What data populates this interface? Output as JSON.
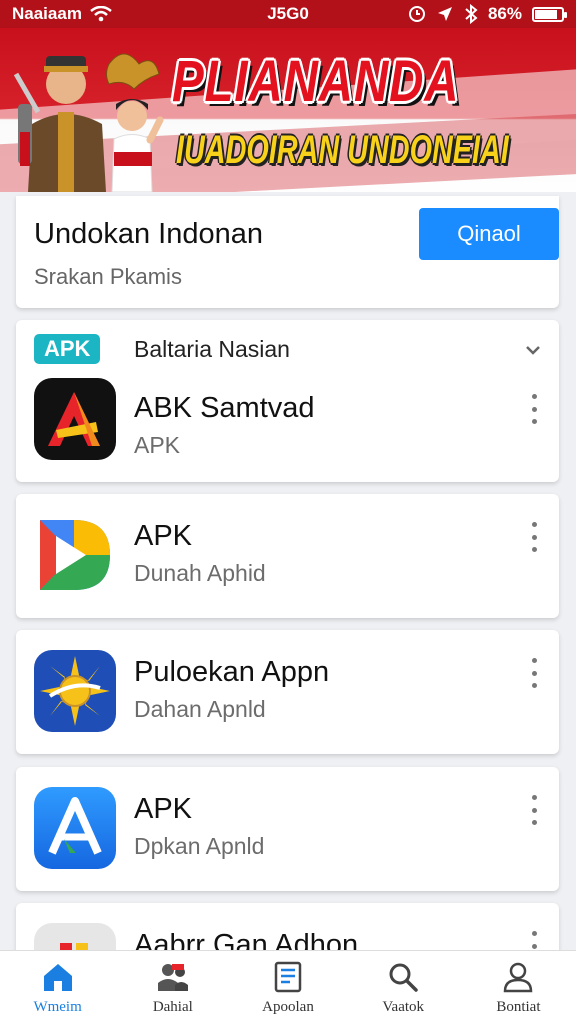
{
  "status_bar": {
    "carrier": "Naaiaam",
    "time": "J5G0",
    "battery": "86%",
    "battery_level": 0.86
  },
  "banner": {
    "title": "PLIANANDA",
    "subtitle": "IUADOIRAN UNDONEIAI"
  },
  "search": {
    "title": "Undokan Indonan",
    "subtitle": "Srakan Pkamis",
    "button_label": "Qinaol"
  },
  "section": {
    "badge": "APK",
    "title": "Baltaria Nasian"
  },
  "apps": [
    {
      "name": "ABK Samtvad",
      "sub": "APK",
      "icon": "red-a-triangle-icon"
    },
    {
      "name": "APK",
      "sub": "Dunah Aphid",
      "icon": "colorful-d-play-icon"
    },
    {
      "name": "Puloekan Appn",
      "sub": "Dahan Apnld",
      "icon": "sun-emblem-icon"
    },
    {
      "name": "APK",
      "sub": "Dpkan Apnld",
      "icon": "blue-a-store-icon"
    },
    {
      "name": "Aabrr Gan Adhon",
      "sub": "",
      "icon": "gray-app-icon"
    }
  ],
  "nav": [
    {
      "label": "Wmeim",
      "icon": "home-icon",
      "active": true
    },
    {
      "label": "Dahial",
      "icon": "people-icon",
      "active": false
    },
    {
      "label": "Apoolan",
      "icon": "document-icon",
      "active": false
    },
    {
      "label": "Vaatok",
      "icon": "search-icon",
      "active": false
    },
    {
      "label": "Bontiat",
      "icon": "profile-icon",
      "active": false
    }
  ],
  "colors": {
    "brand_red": "#c8101c",
    "accent_blue": "#1a8cff",
    "badge_teal": "#1cb5c4",
    "nav_active": "#1a7fe0"
  }
}
